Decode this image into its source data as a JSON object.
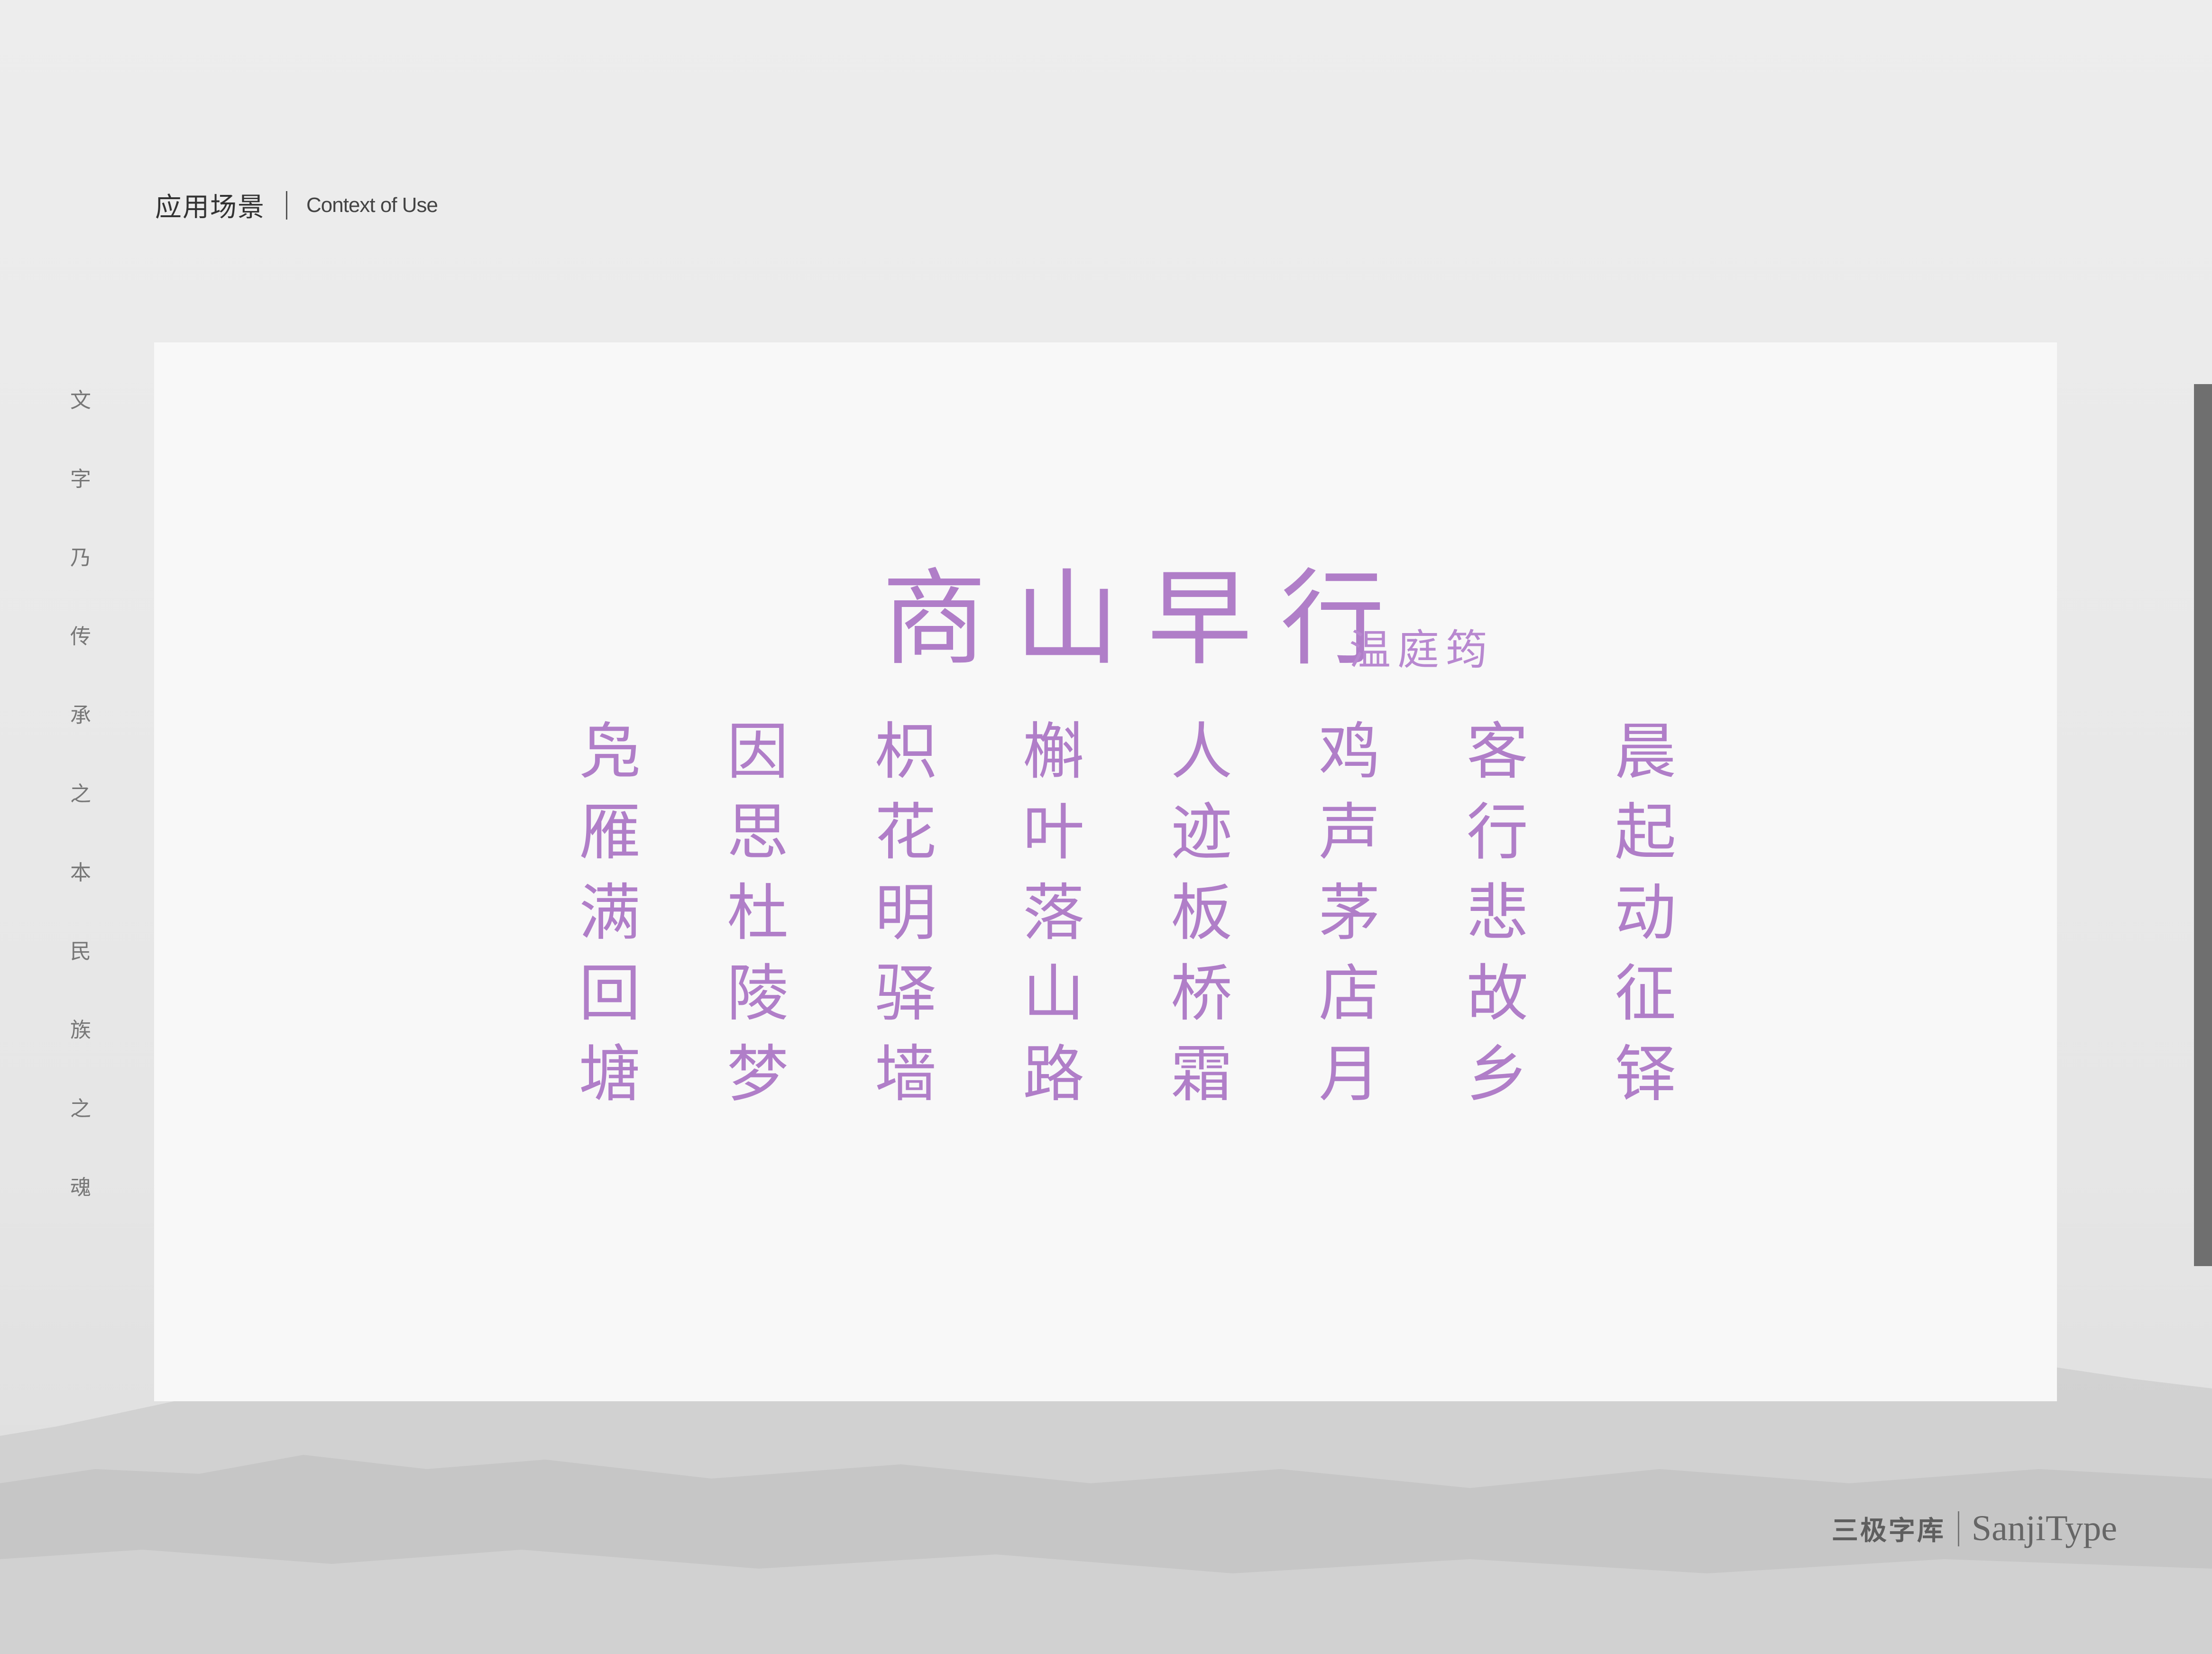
{
  "header": {
    "title_zh": "应用场景",
    "title_en": "Context of Use"
  },
  "side_text": [
    "文",
    "字",
    "乃",
    "传",
    "承",
    "之",
    "本",
    "民",
    "族",
    "之",
    "魂"
  ],
  "poem": {
    "title": "商山早行",
    "author": "温庭筠",
    "columns": [
      [
        "凫",
        "雁",
        "满",
        "回",
        "塘"
      ],
      [
        "因",
        "思",
        "杜",
        "陵",
        "梦"
      ],
      [
        "枳",
        "花",
        "明",
        "驿",
        "墙"
      ],
      [
        "槲",
        "叶",
        "落",
        "山",
        "路"
      ],
      [
        "人",
        "迹",
        "板",
        "桥",
        "霜"
      ],
      [
        "鸡",
        "声",
        "茅",
        "店",
        "月"
      ],
      [
        "客",
        "行",
        "悲",
        "故",
        "乡"
      ],
      [
        "晨",
        "起",
        "动",
        "征",
        "铎"
      ]
    ]
  },
  "brand": {
    "name_zh": "三极字库",
    "name_en": "SanjiType"
  },
  "colors": {
    "accent": "#b07ec8",
    "panel": "#f8f8f8",
    "background": "#ebebeb"
  }
}
